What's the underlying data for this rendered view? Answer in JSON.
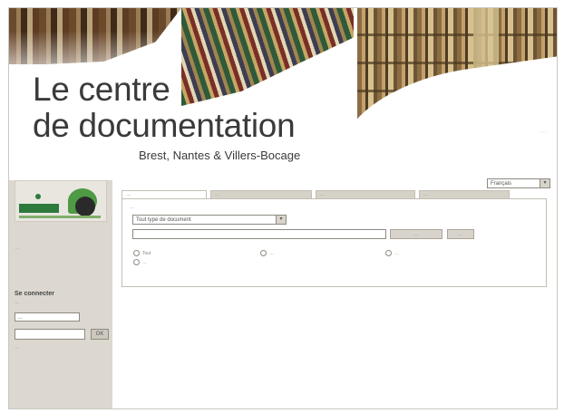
{
  "header": {
    "title_line1": "Le centre",
    "title_line2": "de documentation",
    "subtitle": "Brest, Nantes & Villers-Bocage",
    "tagline": "…"
  },
  "language": {
    "selected": "Français"
  },
  "sidebar": {
    "side_text": "…",
    "connect_title": "Se connecter",
    "connect_hint": "…",
    "login_value": "…",
    "ok_label": "OK",
    "forgot_label": "…"
  },
  "tabs": [
    {
      "label": "…"
    },
    {
      "label": "…"
    },
    {
      "label": "…"
    },
    {
      "label": "…"
    }
  ],
  "search": {
    "intro": "…",
    "type_selected": "Tout type de document",
    "search_button": "…",
    "reset_button": "…",
    "options": [
      {
        "label": "Tout"
      },
      {
        "label": "…"
      },
      {
        "label": "…"
      },
      {
        "label": "…"
      }
    ]
  },
  "colors": {
    "sidebar_bg": "#dcd8cf",
    "tab_bg": "#d6d2c8",
    "title_text": "#3a3a3a",
    "logo_green": "#2e7a3d"
  }
}
